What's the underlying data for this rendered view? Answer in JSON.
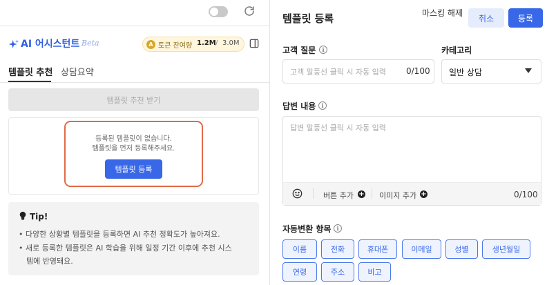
{
  "left": {
    "masking_label": "마스킹 해제",
    "ai_title": "AI 어시스턴트",
    "ai_beta": "Beta",
    "token_label": "토큰 잔여량",
    "token_used": "1.2M",
    "token_sep": "/",
    "token_total": "3.0M",
    "tabs": [
      {
        "label": "템플릿 추천"
      },
      {
        "label": "상담요약"
      }
    ],
    "recommend_button": "템플릿 추천 받기",
    "empty_line1": "등록된 템플릿이 없습니다.",
    "empty_line2": "템플릿을 먼저 등록해주세요.",
    "register_button": "템플릿 등록",
    "tip_title": "Tip!",
    "tips": [
      "• 다양한 상황별 템플릿을 등록하면 AI 추천 정확도가 높아져요.",
      "• 새로 등록한 템플릿은 AI 학습을 위해 일정 기간 이후에 추천 시스",
      "템에 반영돼요."
    ]
  },
  "right": {
    "title": "템플릿 등록",
    "cancel_label": "취소",
    "save_label": "등록",
    "question_label": "고객 질문",
    "question_placeholder": "고객 말풍선 클릭 시 자동 입력",
    "question_count": "0/100",
    "category_label": "카테고리",
    "category_value": "일반 상담",
    "answer_label": "답변 내용",
    "answer_placeholder": "답변 말풍선 클릭 시 자동 입력",
    "add_button_label": "버튼 추가",
    "add_image_label": "이미지 추가",
    "answer_count": "0/100",
    "auto_fields_label": "자동변환 항목",
    "chips": [
      "이름",
      "전화",
      "휴대폰",
      "이메일",
      "성별",
      "생년월일",
      "연령",
      "주소",
      "비고"
    ]
  },
  "colors": {
    "accent": "#3867e8",
    "highlight": "#e06a47",
    "token_bg": "#fff6dc"
  },
  "icons": [
    "refresh-icon",
    "sparkle-icon",
    "coin-icon",
    "panel-toggle-icon",
    "bulb-icon",
    "info-icon",
    "chevron-down-icon",
    "emoji-icon",
    "plus-circle-icon"
  ]
}
